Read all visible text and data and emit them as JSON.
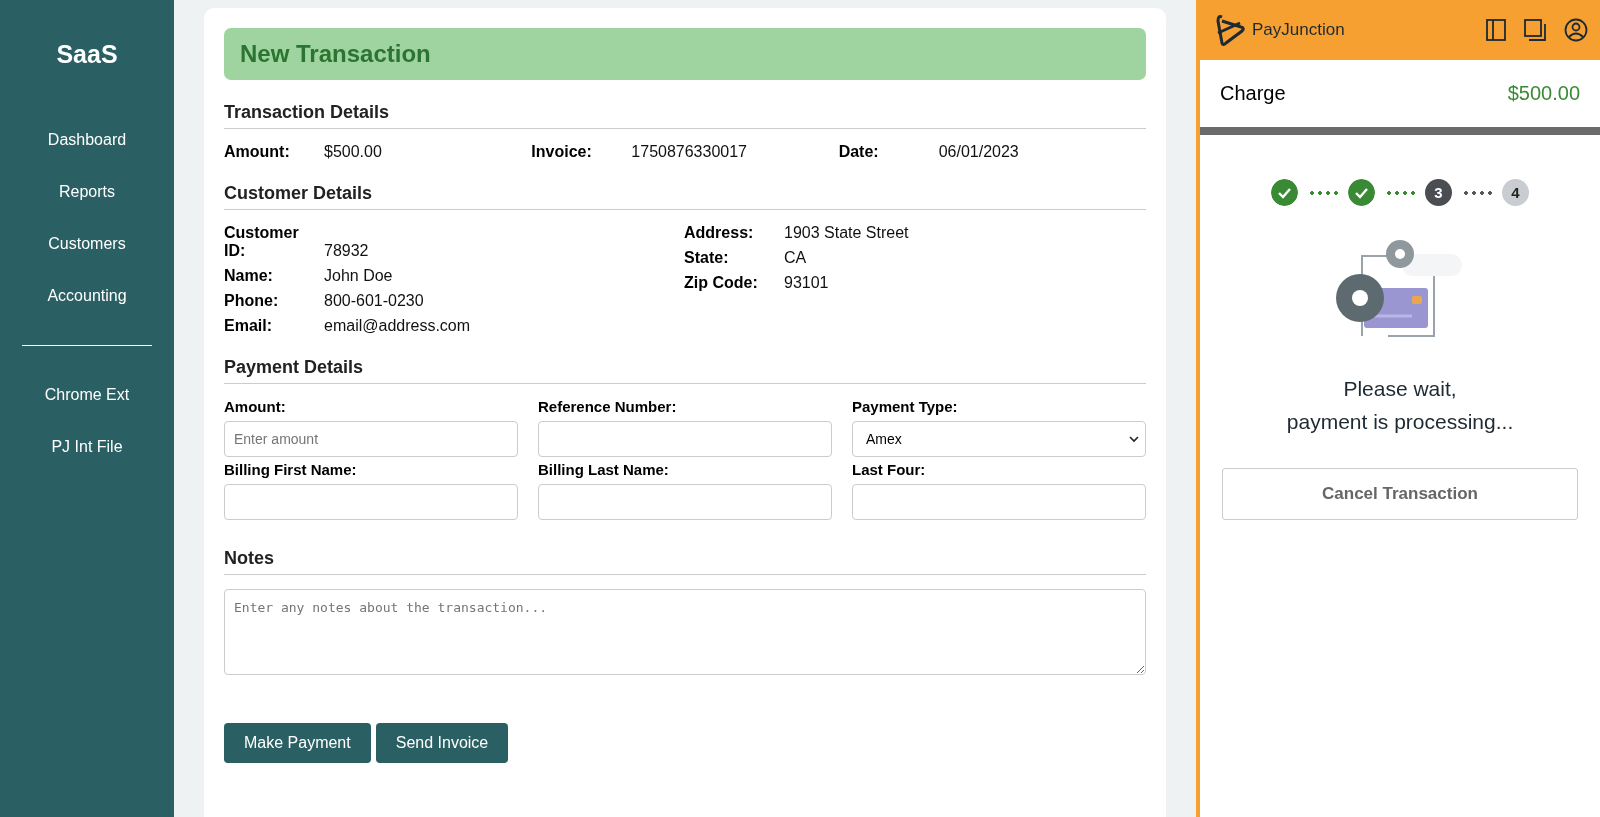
{
  "sidebar": {
    "logo": "SaaS",
    "items": [
      {
        "label": "Dashboard",
        "kind": "link"
      },
      {
        "label": "Reports",
        "kind": "link"
      },
      {
        "label": "Customers",
        "kind": "link"
      },
      {
        "label": "Accounting",
        "kind": "link"
      },
      {
        "kind": "divider"
      },
      {
        "label": "Chrome Ext",
        "kind": "link"
      },
      {
        "label": "PJ Int File",
        "kind": "link"
      }
    ]
  },
  "form": {
    "title": "New Transaction",
    "transaction": {
      "heading": "Transaction Details",
      "fields": [
        {
          "label": "Amount:",
          "value": "$500.00"
        },
        {
          "label": "Invoice:",
          "value": "1750876330017"
        },
        {
          "label": "Date:",
          "value": "06/01/2023"
        }
      ]
    },
    "customer": {
      "heading": "Customer Details",
      "left": [
        {
          "label": "Customer ID:",
          "value": "78932"
        },
        {
          "label": "Name:",
          "value": "John Doe"
        },
        {
          "label": "Phone:",
          "value": "800-601-0230"
        },
        {
          "label": "Email:",
          "value": "email@address.com"
        }
      ],
      "right": [
        {
          "label": "Address:",
          "value": "1903 State Street"
        },
        {
          "label": "State:",
          "value": "CA"
        },
        {
          "label": "Zip Code:",
          "value": "93101"
        }
      ]
    },
    "payment": {
      "heading": "Payment Details",
      "fields": [
        {
          "label": "Amount:",
          "kind": "input",
          "placeholder": "Enter amount"
        },
        {
          "label": "Reference Number:",
          "kind": "input"
        },
        {
          "label": "Payment Type:",
          "kind": "select",
          "value": "Amex"
        },
        {
          "label": "Billing First Name:",
          "kind": "input"
        },
        {
          "label": "Billing Last Name:",
          "kind": "input"
        },
        {
          "label": "Last Four:",
          "kind": "input"
        }
      ]
    },
    "notes": {
      "heading": "Notes",
      "placeholder": "Enter any notes about the transaction..."
    },
    "buttons": [
      "Make Payment",
      "Send Invoice"
    ]
  },
  "panel": {
    "brand": "PayJunction",
    "charge_label": "Charge",
    "charge_amount": "$500.00",
    "steps": [
      {
        "kind": "done"
      },
      {
        "kind": "done"
      },
      {
        "label": "3",
        "kind": "current"
      },
      {
        "label": "4",
        "kind": "pending"
      }
    ],
    "message": [
      "Please wait,",
      "payment is processing..."
    ],
    "cancel_button": "Cancel Transaction"
  }
}
